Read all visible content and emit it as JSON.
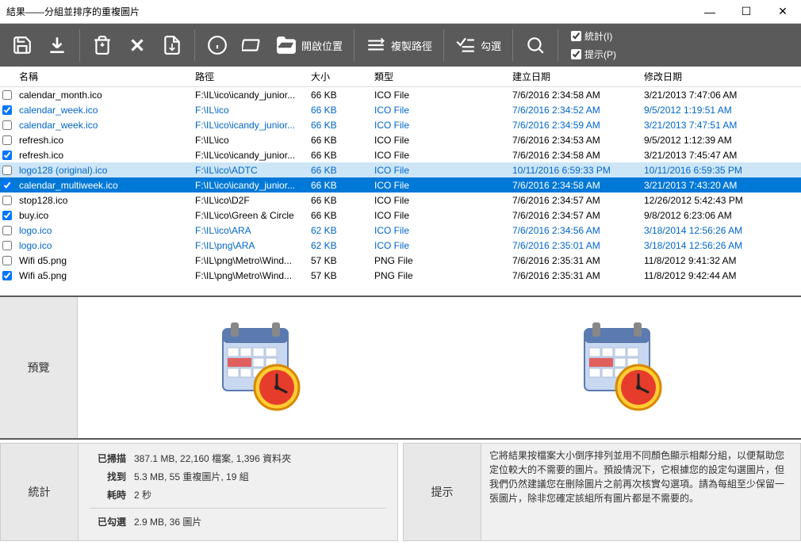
{
  "window": {
    "title": "結果——分組並排序的重複圖片"
  },
  "toolbar": {
    "open_location": "開啟位置",
    "copy_path": "複製路徑",
    "check": "勾選",
    "opt_stats": "統計(I)",
    "opt_hint": "提示(P)"
  },
  "columns": {
    "name": "名稱",
    "path": "路徑",
    "size": "大小",
    "type": "類型",
    "created": "建立日期",
    "modified": "修改日期"
  },
  "rows": [
    {
      "chk": false,
      "blue": false,
      "name": "calendar_month.ico",
      "path": "F:\\IL\\ico\\icandy_junior...",
      "size": "66 KB",
      "type": "ICO File",
      "created": "7/6/2016 2:34:58 AM",
      "modified": "3/21/2013 7:47:06 AM"
    },
    {
      "chk": true,
      "blue": true,
      "name": "calendar_week.ico",
      "path": "F:\\IL\\ico",
      "size": "66 KB",
      "type": "ICO File",
      "created": "7/6/2016 2:34:52 AM",
      "modified": "9/5/2012 1:19:51 AM"
    },
    {
      "chk": false,
      "blue": true,
      "name": "calendar_week.ico",
      "path": "F:\\IL\\ico\\icandy_junior...",
      "size": "66 KB",
      "type": "ICO File",
      "created": "7/6/2016 2:34:59 AM",
      "modified": "3/21/2013 7:47:51 AM"
    },
    {
      "chk": false,
      "blue": false,
      "name": "refresh.ico",
      "path": "F:\\IL\\ico",
      "size": "66 KB",
      "type": "ICO File",
      "created": "7/6/2016 2:34:53 AM",
      "modified": "9/5/2012 1:12:39 AM"
    },
    {
      "chk": true,
      "blue": false,
      "name": "refresh.ico",
      "path": "F:\\IL\\ico\\icandy_junior...",
      "size": "66 KB",
      "type": "ICO File",
      "created": "7/6/2016 2:34:58 AM",
      "modified": "3/21/2013 7:45:47 AM"
    },
    {
      "chk": false,
      "blue": true,
      "hl": true,
      "name": "logo128 (original).ico",
      "path": "F:\\IL\\ico\\ADTC",
      "size": "66 KB",
      "type": "ICO File",
      "created": "10/11/2016 6:59:33 PM",
      "modified": "10/11/2016 6:59:35 PM"
    },
    {
      "chk": true,
      "blue": false,
      "sel": true,
      "name": "calendar_multiweek.ico",
      "path": "F:\\IL\\ico\\icandy_junior...",
      "size": "66 KB",
      "type": "ICO File",
      "created": "7/6/2016 2:34:58 AM",
      "modified": "3/21/2013 7:43:20 AM"
    },
    {
      "chk": false,
      "blue": false,
      "name": "stop128.ico",
      "path": "F:\\IL\\ico\\D2F",
      "size": "66 KB",
      "type": "ICO File",
      "created": "7/6/2016 2:34:57 AM",
      "modified": "12/26/2012 5:42:43 PM"
    },
    {
      "chk": true,
      "blue": false,
      "name": "buy.ico",
      "path": "F:\\IL\\ico\\Green & Circle",
      "size": "66 KB",
      "type": "ICO File",
      "created": "7/6/2016 2:34:57 AM",
      "modified": "9/8/2012 6:23:06 AM"
    },
    {
      "chk": false,
      "blue": true,
      "name": "logo.ico",
      "path": "F:\\IL\\ico\\ARA",
      "size": "62 KB",
      "type": "ICO File",
      "created": "7/6/2016 2:34:56 AM",
      "modified": "3/18/2014 12:56:26 AM"
    },
    {
      "chk": false,
      "blue": true,
      "name": "logo.ico",
      "path": "F:\\IL\\png\\ARA",
      "size": "62 KB",
      "type": "ICO File",
      "created": "7/6/2016 2:35:01 AM",
      "modified": "3/18/2014 12:56:26 AM"
    },
    {
      "chk": false,
      "blue": false,
      "name": "Wifi d5.png",
      "path": "F:\\IL\\png\\Metro\\Wind...",
      "size": "57 KB",
      "type": "PNG File",
      "created": "7/6/2016 2:35:31 AM",
      "modified": "11/8/2012 9:41:32 AM"
    },
    {
      "chk": true,
      "blue": false,
      "name": "Wifi a5.png",
      "path": "F:\\IL\\png\\Metro\\Wind...",
      "size": "57 KB",
      "type": "PNG File",
      "created": "7/6/2016 2:35:31 AM",
      "modified": "11/8/2012 9:42:44 AM"
    }
  ],
  "preview": {
    "label": "預覽"
  },
  "stats": {
    "label": "統計",
    "scanned_k": "已掃描",
    "scanned_v": "387.1 MB, 22,160 檔案, 1,396 資料夾",
    "found_k": "找到",
    "found_v": "5.3 MB, 55 重複圖片, 19 組",
    "time_k": "耗時",
    "time_v": "2 秒",
    "checked_k": "已勾選",
    "checked_v": "2.9 MB, 36 圖片"
  },
  "hint": {
    "label": "提示",
    "text": "它將結果按檔案大小倒序排列並用不同顏色顯示相鄰分組，以便幫助您定位較大的不需要的圖片。預設情況下，它根據您的設定勾選圖片，但我們仍然建議您在刪除圖片之前再次核實勾選項。請為每組至少保留一張圖片，除非您確定該組所有圖片都是不需要的。"
  }
}
